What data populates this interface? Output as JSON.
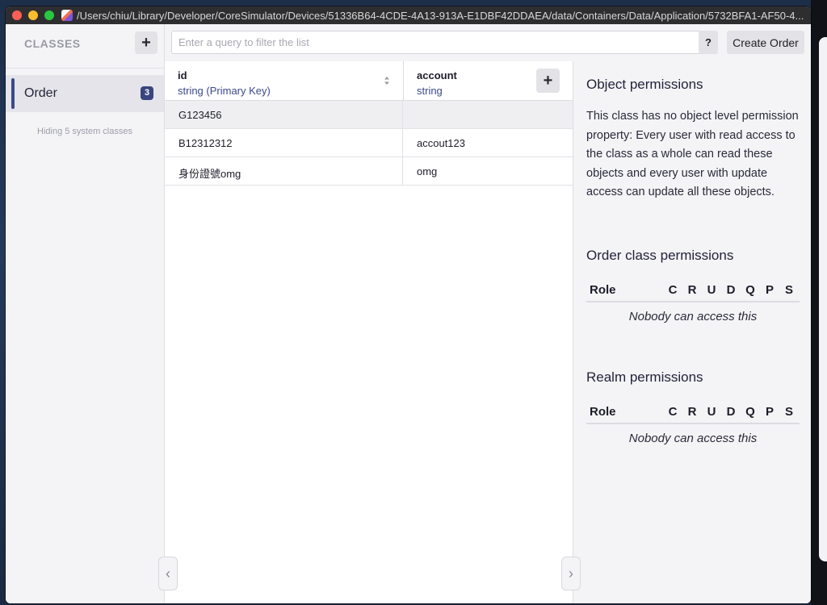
{
  "window": {
    "title": "/Users/chiu/Library/Developer/CoreSimulator/Devices/51336B64-4CDE-4A13-913A-E1DBF42DDAEA/data/Containers/Data/Application/5732BFA1-AF50-4..."
  },
  "sidebar": {
    "title": "CLASSES",
    "add_label": "+",
    "items": [
      {
        "label": "Order",
        "count": "3"
      }
    ],
    "hiding_note": "Hiding 5 system classes"
  },
  "query": {
    "placeholder": "Enter a query to filter the list",
    "help_label": "?",
    "create_label": "Create Order"
  },
  "table": {
    "columns": [
      {
        "name": "id",
        "type": "string (Primary Key)"
      },
      {
        "name": "account",
        "type": "string"
      }
    ],
    "add_column_label": "+",
    "rows": [
      {
        "id": "G123456",
        "account": ""
      },
      {
        "id": "B12312312",
        "account": "accout123"
      },
      {
        "id": "身份證號omg",
        "account": "omg"
      }
    ]
  },
  "permissions": {
    "object_title": "Object permissions",
    "object_text": "This class has no object level permission property: Every user with read access to the class as a whole can read these objects and every user with update access can update all these objects.",
    "class_title": "Order class permissions",
    "class_table": {
      "role_label": "Role",
      "letters": [
        "C",
        "R",
        "U",
        "D",
        "Q",
        "P",
        "S"
      ],
      "empty": "Nobody can access this"
    },
    "realm_title": "Realm permissions",
    "realm_table": {
      "role_label": "Role",
      "letters": [
        "C",
        "R",
        "U",
        "D",
        "Q",
        "P",
        "S"
      ],
      "empty": "Nobody can access this"
    }
  },
  "colors": {
    "accent": "#3b4a8b",
    "badge": "#38457e",
    "sidebar_bg": "#f4f4f7"
  },
  "icons": {
    "collapse_left": "chevron-left-icon",
    "collapse_right": "chevron-right-icon",
    "sort": "sort-icon"
  }
}
